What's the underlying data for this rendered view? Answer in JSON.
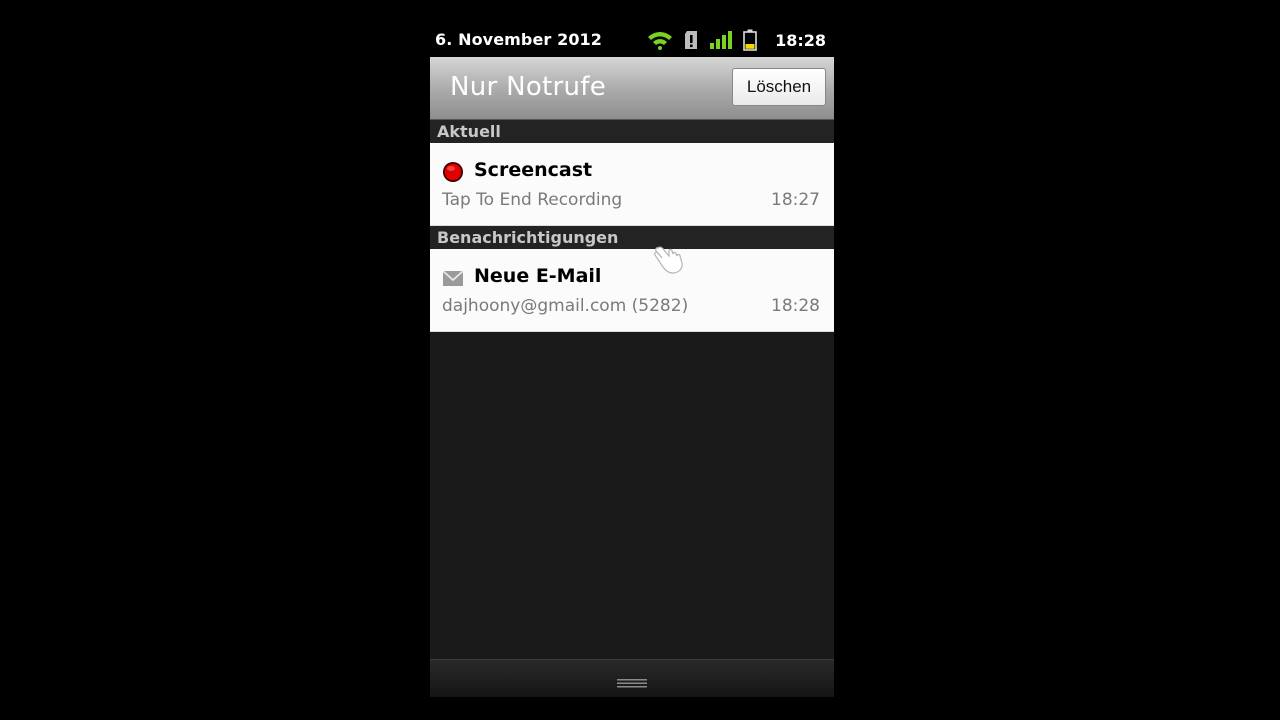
{
  "statusbar": {
    "date": "6. November 2012",
    "time": "18:28",
    "icons": [
      "wifi-icon",
      "sd-card-alert-icon",
      "signal-icon",
      "battery-icon"
    ],
    "colors": {
      "wifi": "#7bd321",
      "signal": "#7bd321",
      "battery_fill": "#f5d800"
    }
  },
  "titlebar": {
    "title": "Nur Notrufe",
    "clear_label": "Löschen"
  },
  "sections": {
    "ongoing": {
      "header": "Aktuell",
      "items": [
        {
          "icon": "record-icon",
          "title": "Screencast",
          "subtitle": "Tap To End Recording",
          "time": "18:27"
        }
      ]
    },
    "notifications": {
      "header": "Benachrichtigungen",
      "items": [
        {
          "icon": "mail-icon",
          "title": "Neue E-Mail",
          "subtitle": "dajhoony@gmail.com (5282)",
          "time": "18:28"
        }
      ]
    }
  }
}
